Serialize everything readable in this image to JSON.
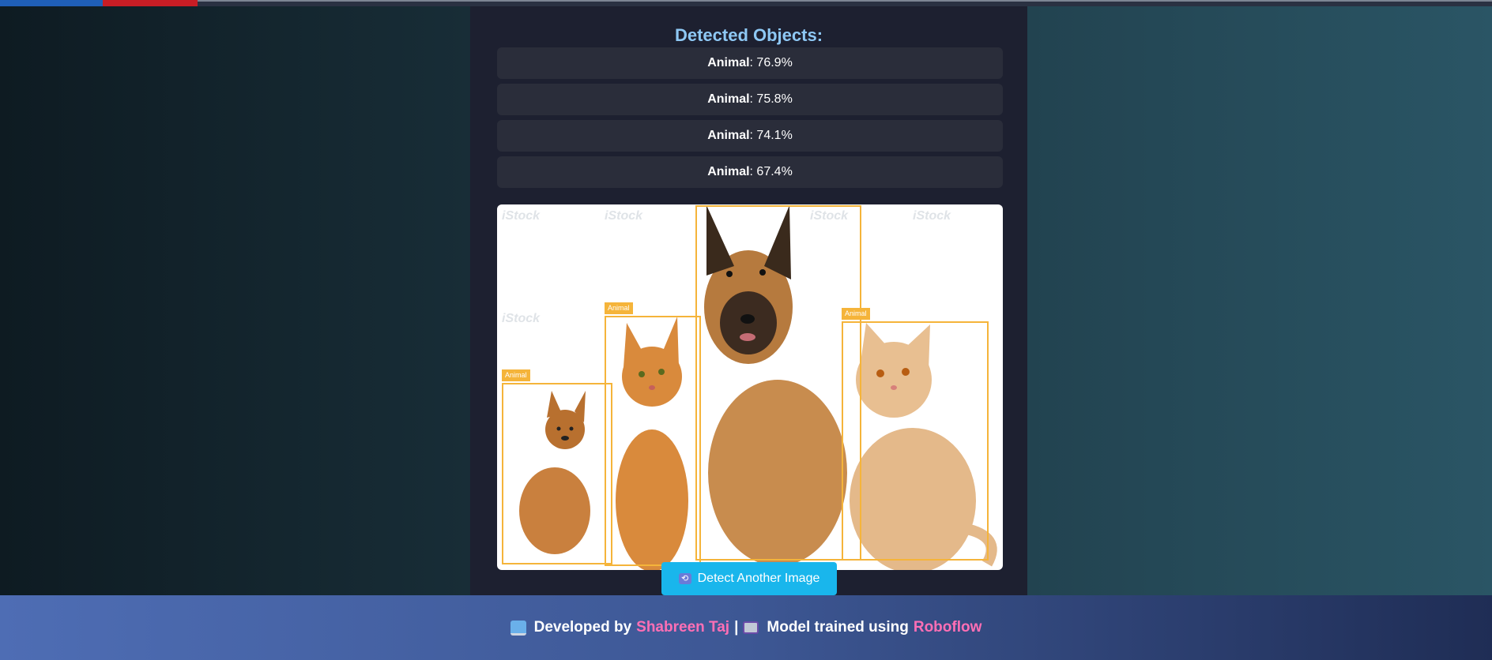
{
  "heading": "Detected Objects:",
  "detections": [
    {
      "label": "Animal",
      "confidence": "76.9%"
    },
    {
      "label": "Animal",
      "confidence": "75.8%"
    },
    {
      "label": "Animal",
      "confidence": "74.1%"
    },
    {
      "label": "Animal",
      "confidence": "67.4%"
    }
  ],
  "image": {
    "box_label": "Animal",
    "watermark": "iStock",
    "accent_color": "#f5b43a"
  },
  "button": {
    "label": "Detect Another Image",
    "icon": "refresh-icon"
  },
  "footer": {
    "developed_by": "Developed by",
    "developer": "Shabreen Taj",
    "separator": "|",
    "trained_text": "Model trained using",
    "platform": "Roboflow",
    "icons": [
      "laptop-icon",
      "robot-icon"
    ]
  }
}
